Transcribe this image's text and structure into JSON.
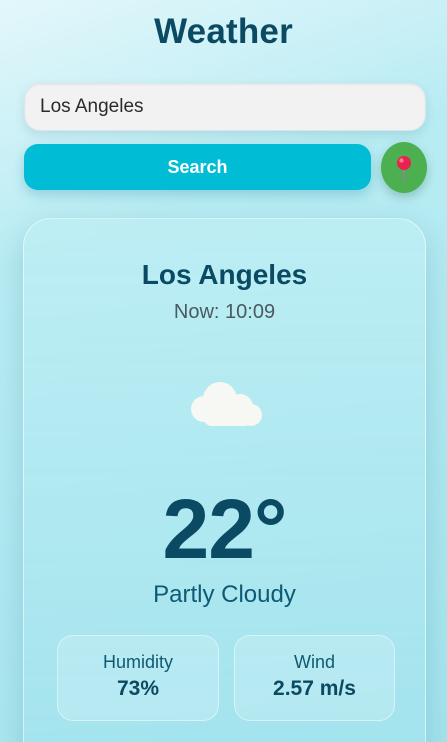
{
  "app": {
    "title": "Weather"
  },
  "search": {
    "value": "Los Angeles",
    "button_label": "Search"
  },
  "location_button": {
    "icon": "map-pin-icon",
    "color": "#4caf50"
  },
  "weather": {
    "city": "Los Angeles",
    "time_label": "Now:",
    "time": "10:09",
    "icon": "cloud-icon",
    "temperature": "22°",
    "condition": "Partly Cloudy",
    "stats": {
      "humidity": {
        "label": "Humidity",
        "value": "73%"
      },
      "wind": {
        "label": "Wind",
        "value": "2.57 m/s"
      }
    }
  },
  "colors": {
    "accent": "#00bcd4",
    "title": "#0b4a63",
    "location": "#4caf50"
  }
}
